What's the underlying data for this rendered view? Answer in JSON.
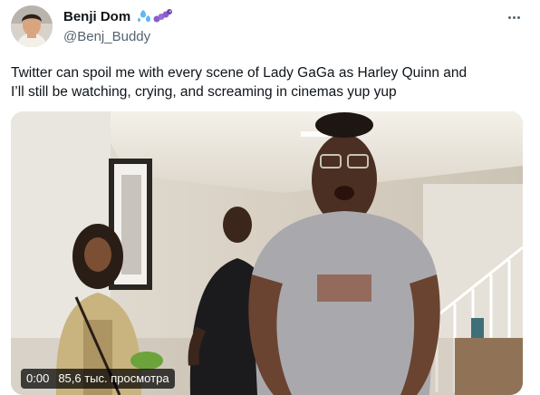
{
  "author": {
    "name": "Benji Dom",
    "handle": "@Benj_Buddy",
    "emoji": [
      "droplets-emoji",
      "caterpillar-emoji"
    ]
  },
  "tweet": {
    "text": "Twitter can spoil me with every scene of Lady GaGa as Harley Quinn and\nI’ll still be watching, crying, and screaming in cinemas yup yup"
  },
  "video": {
    "time": "0:00",
    "views": "85,6 тыс. просмотра"
  },
  "colors": {
    "text": "#0f1419",
    "secondary": "#536471",
    "accent": "#1d9bf0"
  },
  "icons": {
    "more": "more-horizontal-icon"
  }
}
